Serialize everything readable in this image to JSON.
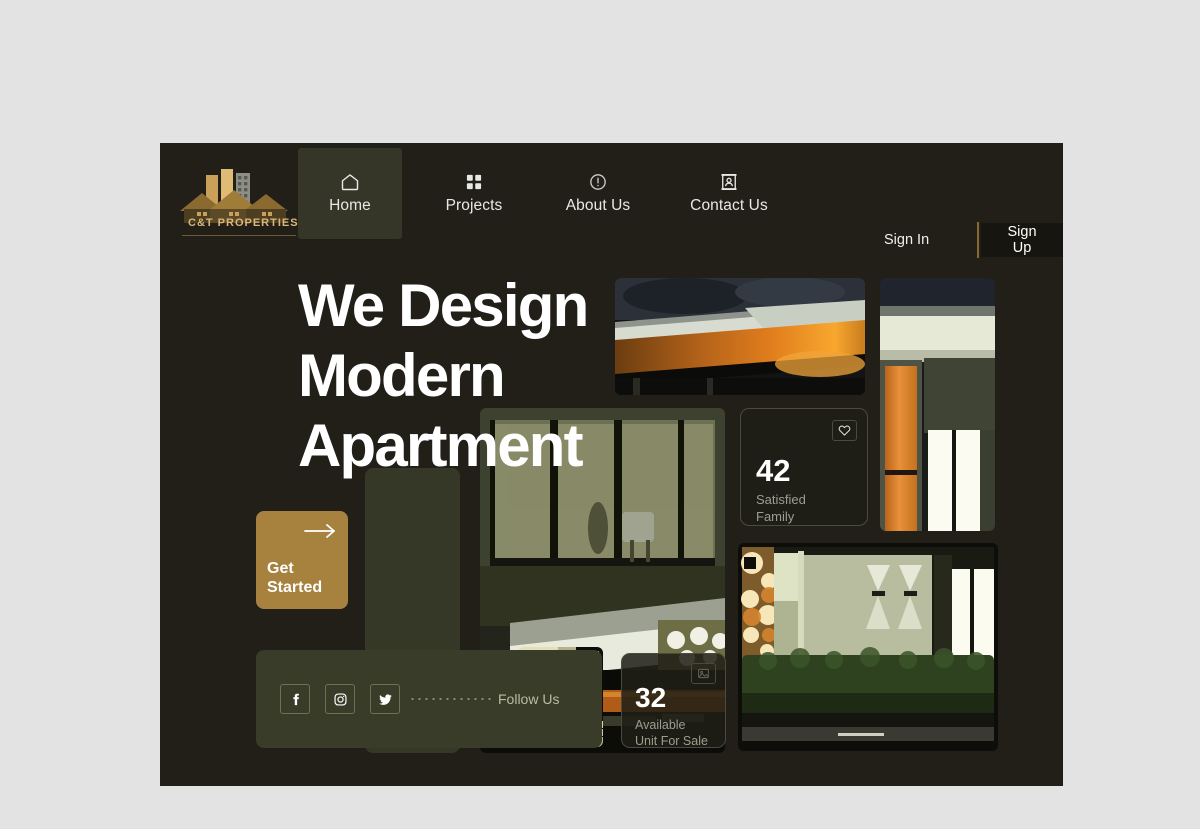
{
  "brand": {
    "name": "C&T PROPERTIES",
    "logo_icon": "buildings-houses-logo-icon"
  },
  "nav": {
    "items": [
      {
        "id": "home",
        "label": "Home",
        "icon": "home-icon",
        "active": true
      },
      {
        "id": "projects",
        "label": "Projects",
        "icon": "grid-icon",
        "active": false
      },
      {
        "id": "about",
        "label": "About Us",
        "icon": "info-circle-icon",
        "active": false
      },
      {
        "id": "contact",
        "label": "Contact Us",
        "icon": "contact-card-icon",
        "active": false
      }
    ]
  },
  "auth": {
    "sign_in_label": "Sign In",
    "sign_up_label": "Sign Up",
    "divider_color": "#8a6a31",
    "sign_up_bg": "#16150f"
  },
  "hero": {
    "headline_line1": "We Design",
    "headline_line2": "Modern",
    "headline_line3": "Apartment",
    "cta": {
      "label_line1": "Get",
      "label_line2": "Started",
      "icon": "arrow-right-icon",
      "color": "#a7823f"
    }
  },
  "stats": [
    {
      "id": "satisfied",
      "value": "42",
      "caption_line1": "Satisfied",
      "caption_line2": "Family",
      "icon": "heart-icon"
    },
    {
      "id": "available",
      "value": "32",
      "caption_line1": "Available",
      "caption_line2": "Unit For Sale",
      "icon": "image-frame-icon"
    }
  ],
  "follow": {
    "label": "Follow Us",
    "socials": [
      {
        "id": "facebook",
        "icon": "facebook-icon"
      },
      {
        "id": "instagram",
        "icon": "instagram-icon"
      },
      {
        "id": "twitter",
        "icon": "twitter-icon"
      }
    ]
  },
  "theme": {
    "page_bg": "#e3e3e3",
    "canvas_bg": "#211f18",
    "olive_card": "#353826",
    "follow_bar_bg": "#3a3c2a",
    "active_nav_bg": "#353528",
    "accent_gold": "#a7823f",
    "text_primary": "#ffffff",
    "text_muted": "#9d9d92"
  }
}
